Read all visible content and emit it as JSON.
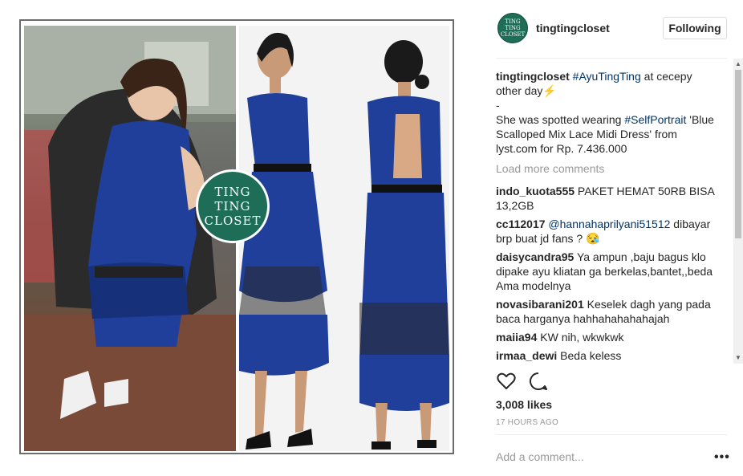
{
  "post": {
    "watermark_lines": [
      "TING TING",
      "CLOSET"
    ],
    "image_alt": "Ting Ting Closet post image"
  },
  "header": {
    "avatar_lines": [
      "TING TING",
      "CLOSET"
    ],
    "username": "tingtingcloset",
    "follow_label": "Following"
  },
  "caption": {
    "username": "tingtingcloset",
    "hashtag1": "#AyuTingTing",
    "text1": " at cecepy other day⚡",
    "dash": "-",
    "text2": "She was spotted wearing ",
    "hashtag2": "#SelfPortrait",
    "text3": " 'Blue Scalloped Mix Lace Midi Dress' from lyst.com for Rp. 7.436.000"
  },
  "load_more": "Load more comments",
  "comments": [
    {
      "user": "indo_kuota555",
      "mention": "",
      "text": "PAKET HEMAT 50RB BISA 13,2GB"
    },
    {
      "user": "cc112017",
      "mention": "@hannahaprilyani51512",
      "text": " dibayar brp buat jd fans ? 😪"
    },
    {
      "user": "daisycandra95",
      "mention": "",
      "text": "Ya ampun ,baju bagus klo dipake ayu kliatan ga berkelas,bantet,,beda Ama modelnya"
    },
    {
      "user": "novasibarani201",
      "mention": "",
      "text": "Keselek dagh yang pada baca harganya hahhahahahahajah"
    },
    {
      "user": "maiia94",
      "mention": "",
      "text": "KW nih, wkwkwk"
    },
    {
      "user": "irmaa_dewi",
      "mention": "",
      "text": "Beda keless"
    }
  ],
  "icons": {
    "like": "heart-icon",
    "comment": "comment-icon",
    "more": "more-options-icon"
  },
  "likes": "3,008 likes",
  "timestamp": "17 HOURS AGO",
  "add_comment_placeholder": "Add a comment...",
  "more_label": "•••",
  "colors": {
    "brand_green": "#1d6d57",
    "link_blue": "#003569",
    "muted": "#999999"
  }
}
